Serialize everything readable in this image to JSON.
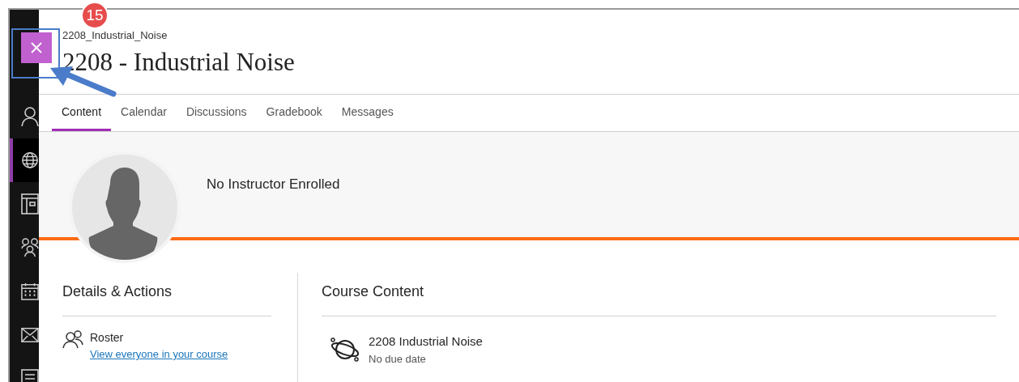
{
  "annotation": {
    "step": "15"
  },
  "course": {
    "breadcrumb": "2208_Industrial_Noise",
    "title": "2208 - Industrial Noise"
  },
  "sidebar": {
    "items": [
      {
        "kind": "person",
        "selected": false
      },
      {
        "kind": "globe",
        "selected": true
      },
      {
        "kind": "book",
        "selected": false
      },
      {
        "kind": "group",
        "selected": false
      },
      {
        "kind": "calendar",
        "selected": false
      },
      {
        "kind": "mail",
        "selected": false
      },
      {
        "kind": "document",
        "selected": false
      }
    ]
  },
  "tabs": [
    {
      "label": "Content",
      "selected": true
    },
    {
      "label": "Calendar",
      "selected": false
    },
    {
      "label": "Discussions",
      "selected": false
    },
    {
      "label": "Gradebook",
      "selected": false
    },
    {
      "label": "Messages",
      "selected": false
    }
  ],
  "instructor": {
    "name": "No Instructor Enrolled"
  },
  "details": {
    "heading": "Details & Actions",
    "items": [
      {
        "title": "Roster",
        "link": "View everyone in your course"
      }
    ]
  },
  "course_content": {
    "heading": "Course Content",
    "items": [
      {
        "title": "2208 Industrial Noise",
        "subtitle": "No due date"
      }
    ]
  }
}
